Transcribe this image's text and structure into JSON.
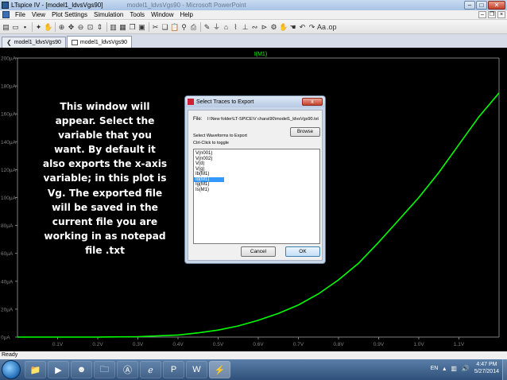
{
  "window": {
    "title": "LTspice IV - [model1_ldvsVgs90]",
    "title_faded": "model1_ldvsVgs90 - Microsoft PowerPoint",
    "minimize": "–",
    "maximize": "□",
    "close": "✕"
  },
  "menu": [
    "File",
    "View",
    "Plot Settings",
    "Simulation",
    "Tools",
    "Window",
    "Help"
  ],
  "tabs": [
    {
      "label": "model1_ldvsVgs90"
    },
    {
      "label": "model1_ldvsVgs90"
    }
  ],
  "plot": {
    "trace_label": "I(M1)",
    "trace_color": "#00ff00",
    "y_ticks": [
      "200µA",
      "180µA",
      "160µA",
      "140µA",
      "120µA",
      "100µA",
      "80µA",
      "60µA",
      "40µA",
      "20µA",
      "0µA"
    ],
    "x_ticks": [
      "0.1V",
      "0.2V",
      "0.3V",
      "0.4V",
      "0.5V",
      "0.6V",
      "0.7V",
      "0.8V",
      "0.9V",
      "1.0V",
      "1.1V"
    ]
  },
  "chart_data": {
    "type": "line",
    "series": [
      {
        "name": "I(M1)",
        "x": [
          0.0,
          0.2,
          0.3,
          0.4,
          0.45,
          0.5,
          0.55,
          0.6,
          0.65,
          0.7,
          0.75,
          0.8,
          0.85,
          0.9,
          0.95,
          1.0,
          1.05,
          1.1,
          1.15,
          1.2
        ],
        "y": [
          0,
          0,
          0.3,
          1.5,
          3,
          5,
          8,
          12,
          17,
          23,
          31,
          41,
          53,
          68,
          84,
          100,
          118,
          138,
          158,
          175
        ]
      }
    ],
    "xlim": [
      0,
      1.2
    ],
    "ylim": [
      0,
      200
    ],
    "grid": false
  },
  "annotation": "This window will appear. Select the variable that you want. By default it also exports the x-axis variable; in this plot is Vg. The exported file will be saved in the current file you are working in as notepad file .txt",
  "dialog": {
    "title": "Select Traces to Export",
    "close": "x",
    "file_label": "File:",
    "file_path": "I:\\New folder\\LT-SPICE\\V chara\\90\\model1_ldvsVgs90.txt",
    "browse": "Browse",
    "select_label": "Select Waveforms to Export",
    "ctrl_label": "Ctrl-Click to toggle",
    "waveforms": [
      "V(n001)",
      "V(n002)",
      "V(d)",
      "V(g)",
      "Ib(M1)",
      "Id(M1)",
      "Ig(M1)",
      "Is(M1)"
    ],
    "selected_index": 5,
    "cancel": "Cancel",
    "ok": "OK"
  },
  "status": "Ready",
  "taskbar": {
    "lang": "EN",
    "time": "4:47 PM",
    "date": "5/27/2014"
  }
}
